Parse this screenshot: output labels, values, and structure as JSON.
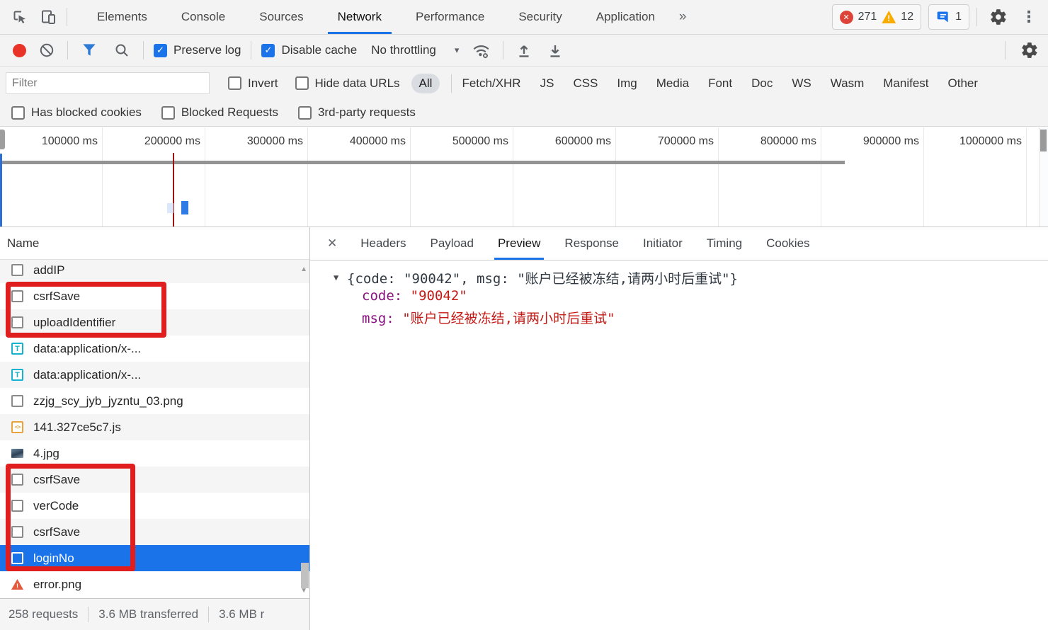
{
  "tabbar": {
    "tabs": [
      "Elements",
      "Console",
      "Sources",
      "Network",
      "Performance",
      "Security",
      "Application"
    ],
    "more": "»",
    "badges": {
      "errors": "271",
      "warnings": "12",
      "issues": "1"
    }
  },
  "toolbar": {
    "preserve_log": "Preserve log",
    "disable_cache": "Disable cache",
    "throttling": "No throttling"
  },
  "filters": {
    "placeholder": "Filter",
    "invert": "Invert",
    "hide_data_urls": "Hide data URLs",
    "types": [
      "All",
      "Fetch/XHR",
      "JS",
      "CSS",
      "Img",
      "Media",
      "Font",
      "Doc",
      "WS",
      "Wasm",
      "Manifest",
      "Other"
    ]
  },
  "options": {
    "items": [
      "Has blocked cookies",
      "Blocked Requests",
      "3rd-party requests"
    ]
  },
  "timeline": {
    "ticks": [
      "100000 ms",
      "200000 ms",
      "300000 ms",
      "400000 ms",
      "500000 ms",
      "600000 ms",
      "700000 ms",
      "800000 ms",
      "900000 ms",
      "1000000 ms"
    ]
  },
  "requests": {
    "header": "Name",
    "rows": [
      {
        "name": "addIP",
        "icon": "document-icon"
      },
      {
        "name": "csrfSave",
        "icon": "document-icon"
      },
      {
        "name": "uploadIdentifier",
        "icon": "document-icon"
      },
      {
        "name": "data:application/x-...",
        "icon": "text-icon"
      },
      {
        "name": "data:application/x-...",
        "icon": "text-icon"
      },
      {
        "name": "zzjg_scy_jyb_jyzntu_03.png",
        "icon": "document-icon"
      },
      {
        "name": "141.327ce5c7.js",
        "icon": "script-icon"
      },
      {
        "name": "4.jpg",
        "icon": "image-icon"
      },
      {
        "name": "csrfSave",
        "icon": "document-icon"
      },
      {
        "name": "verCode",
        "icon": "document-icon"
      },
      {
        "name": "csrfSave",
        "icon": "document-icon"
      },
      {
        "name": "loginNo",
        "icon": "document-icon",
        "selected": true
      },
      {
        "name": "error.png",
        "icon": "error-icon"
      }
    ]
  },
  "detail": {
    "close": "✕",
    "tabs": [
      "Headers",
      "Payload",
      "Preview",
      "Response",
      "Initiator",
      "Timing",
      "Cookies"
    ],
    "active_tab": "Preview"
  },
  "preview": {
    "summary": "{code: \"90042\", msg: \"账户已经被冻结,请两小时后重试\"}",
    "code_key": "code:",
    "code_value": "\"90042\"",
    "msg_key": "msg:",
    "msg_value": "\"账户已经被冻结,请两小时后重试\""
  },
  "statusbar": {
    "items": [
      "258 requests",
      "3.6 MB transferred",
      "3.6 MB r"
    ]
  },
  "icons": {
    "text": "T",
    "script": "<>",
    "warning_mark": "!",
    "error_mark": "!",
    "error_x": "✕",
    "check": "✓",
    "caret": "▾",
    "expand": "▼",
    "up": "▲",
    "down": "▼",
    "kebab": "⋮"
  },
  "colors": {
    "accent": "#1a73e8",
    "selection": "#1a73e8",
    "annotation": "#e01e1e",
    "record": "#ea3328",
    "error_badge": "#dd4437",
    "warning_badge": "#f9ab00",
    "json_key": "#881280",
    "json_string": "#c41a16"
  }
}
